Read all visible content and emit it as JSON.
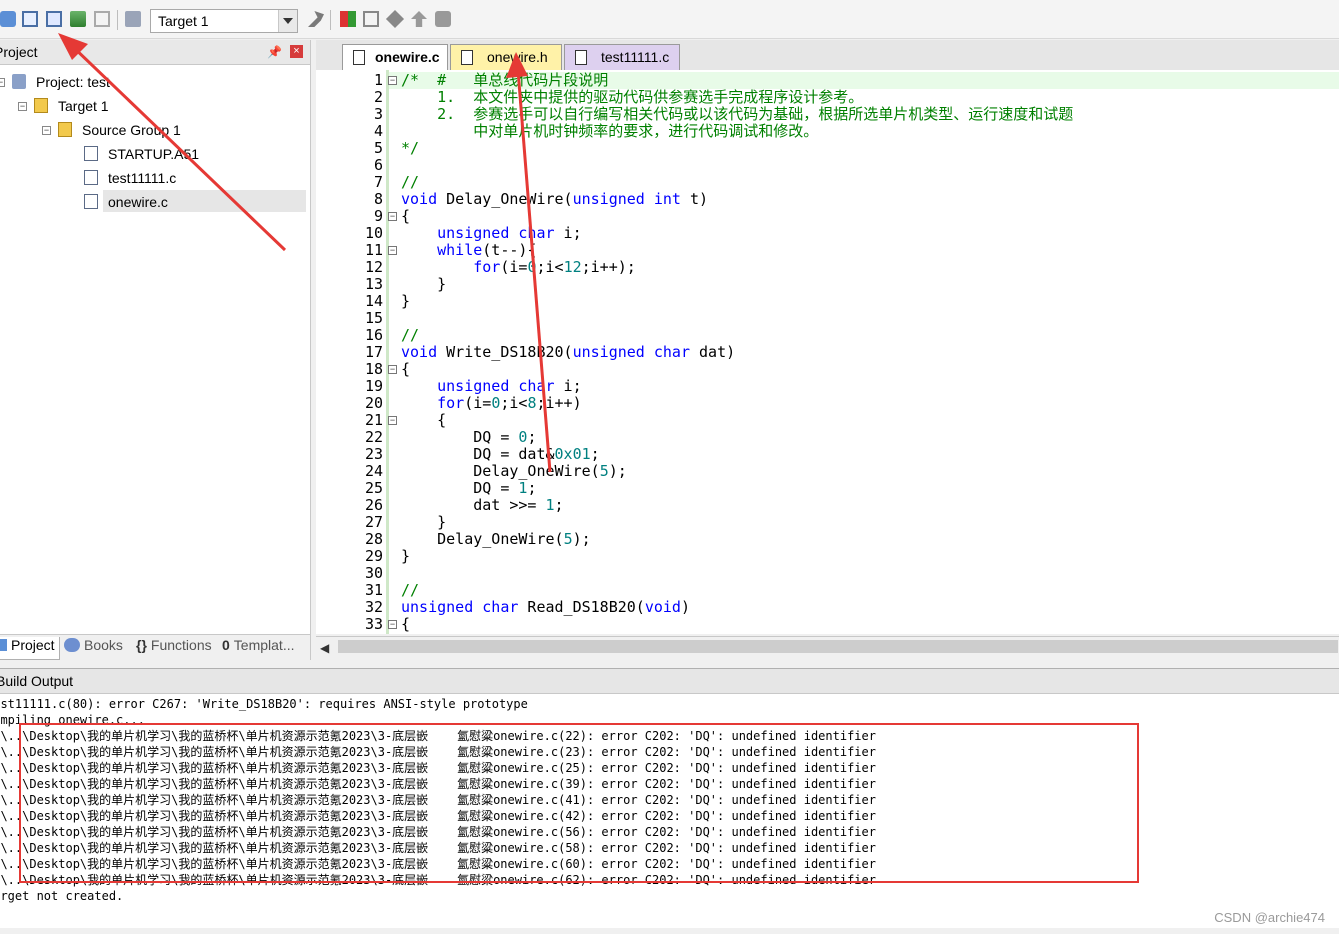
{
  "toolbar": {
    "target": "Target 1",
    "icons": [
      "translate-icon",
      "build-icon",
      "rebuild-icon",
      "batch-build-icon",
      "stop-build-icon",
      "download-icon",
      "options-icon",
      "manage-components-icon",
      "select-packs-icon",
      "pack-installer-icon",
      "manage-env-icon"
    ]
  },
  "project_panel": {
    "title": "Project",
    "tree": [
      {
        "label": "Project: test",
        "name": "tree-project-root"
      },
      {
        "label": "Target 1",
        "name": "tree-target-1"
      },
      {
        "label": "Source Group 1",
        "name": "tree-source-group-1"
      },
      {
        "label": "STARTUP.A51",
        "name": "tree-file-startup"
      },
      {
        "label": "test11111.c",
        "name": "tree-file-test11111"
      },
      {
        "label": "onewire.c",
        "name": "tree-file-onewire"
      }
    ],
    "tabs": [
      "Project",
      "Books",
      "Functions",
      "Templat..."
    ]
  },
  "editor": {
    "tabs": [
      {
        "label": "onewire.c",
        "active": true
      },
      {
        "label": "onewire.h",
        "active": false
      },
      {
        "label": "test11111.c",
        "active": false
      }
    ],
    "lines": [
      "/*  #   单总线代码片段说明",
      "    1.  本文件夹中提供的驱动代码供参赛选手完成程序设计参考。",
      "    2.  参赛选手可以自行编写相关代码或以该代码为基础，根据所选单片机类型、运行速度和试题",
      "        中对单片机时钟频率的要求，进行代码调试和修改。",
      "*/",
      "",
      "//",
      "void Delay_OneWire(unsigned int t)",
      "{",
      "    unsigned char i;",
      "    while(t--){",
      "        for(i=0;i<12;i++);",
      "    }",
      "}",
      "",
      "//",
      "void Write_DS18B20(unsigned char dat)",
      "{",
      "    unsigned char i;",
      "    for(i=0;i<8;i++)",
      "    {",
      "        DQ = 0;",
      "        DQ = dat&0x01;",
      "        Delay_OneWire(5);",
      "        DQ = 1;",
      "        dat >>= 1;",
      "    }",
      "    Delay_OneWire(5);",
      "}",
      "",
      "//",
      "unsigned char Read_DS18B20(void)",
      "{"
    ]
  },
  "build_output": {
    "title": "Build Output",
    "lines": [
      "test11111.c(80): error C267: 'Write_DS18B20': requires ANSI-style prototype",
      "compiling onewire.c...",
      "..\\..\\Desktop\\我的单片机学习\\我的蓝桥杯\\单片机资源示范氪2023\\3-底层嵌    氳慰粱onewire.c(22): error C202: 'DQ': undefined identifier",
      "..\\..\\Desktop\\我的单片机学习\\我的蓝桥杯\\单片机资源示范氪2023\\3-底层嵌    氳慰粱onewire.c(23): error C202: 'DQ': undefined identifier",
      "..\\..\\Desktop\\我的单片机学习\\我的蓝桥杯\\单片机资源示范氪2023\\3-底层嵌    氳慰粱onewire.c(25): error C202: 'DQ': undefined identifier",
      "..\\..\\Desktop\\我的单片机学习\\我的蓝桥杯\\单片机资源示范氪2023\\3-底层嵌    氳慰粱onewire.c(39): error C202: 'DQ': undefined identifier",
      "..\\..\\Desktop\\我的单片机学习\\我的蓝桥杯\\单片机资源示范氪2023\\3-底层嵌    氳慰粱onewire.c(41): error C202: 'DQ': undefined identifier",
      "..\\..\\Desktop\\我的单片机学习\\我的蓝桥杯\\单片机资源示范氪2023\\3-底层嵌    氳慰粱onewire.c(42): error C202: 'DQ': undefined identifier",
      "..\\..\\Desktop\\我的单片机学习\\我的蓝桥杯\\单片机资源示范氪2023\\3-底层嵌    氳慰粱onewire.c(56): error C202: 'DQ': undefined identifier",
      "..\\..\\Desktop\\我的单片机学习\\我的蓝桥杯\\单片机资源示范氪2023\\3-底层嵌    氳慰粱onewire.c(58): error C202: 'DQ': undefined identifier",
      "..\\..\\Desktop\\我的单片机学习\\我的蓝桥杯\\单片机资源示范氪2023\\3-底层嵌    氳慰粱onewire.c(60): error C202: 'DQ': undefined identifier",
      "..\\..\\Desktop\\我的单片机学习\\我的蓝桥杯\\单片机资源示范氪2023\\3-底层嵌    氳慰粱onewire.c(62): error C202: 'DQ': undefined identifier",
      "Target not created."
    ]
  },
  "watermark": "CSDN @archie474",
  "colors": {
    "annotation_red": "#e53935",
    "comment": "#008000",
    "keyword": "#0000ff",
    "number": "#008080",
    "active_tab": "#fff2a8"
  }
}
